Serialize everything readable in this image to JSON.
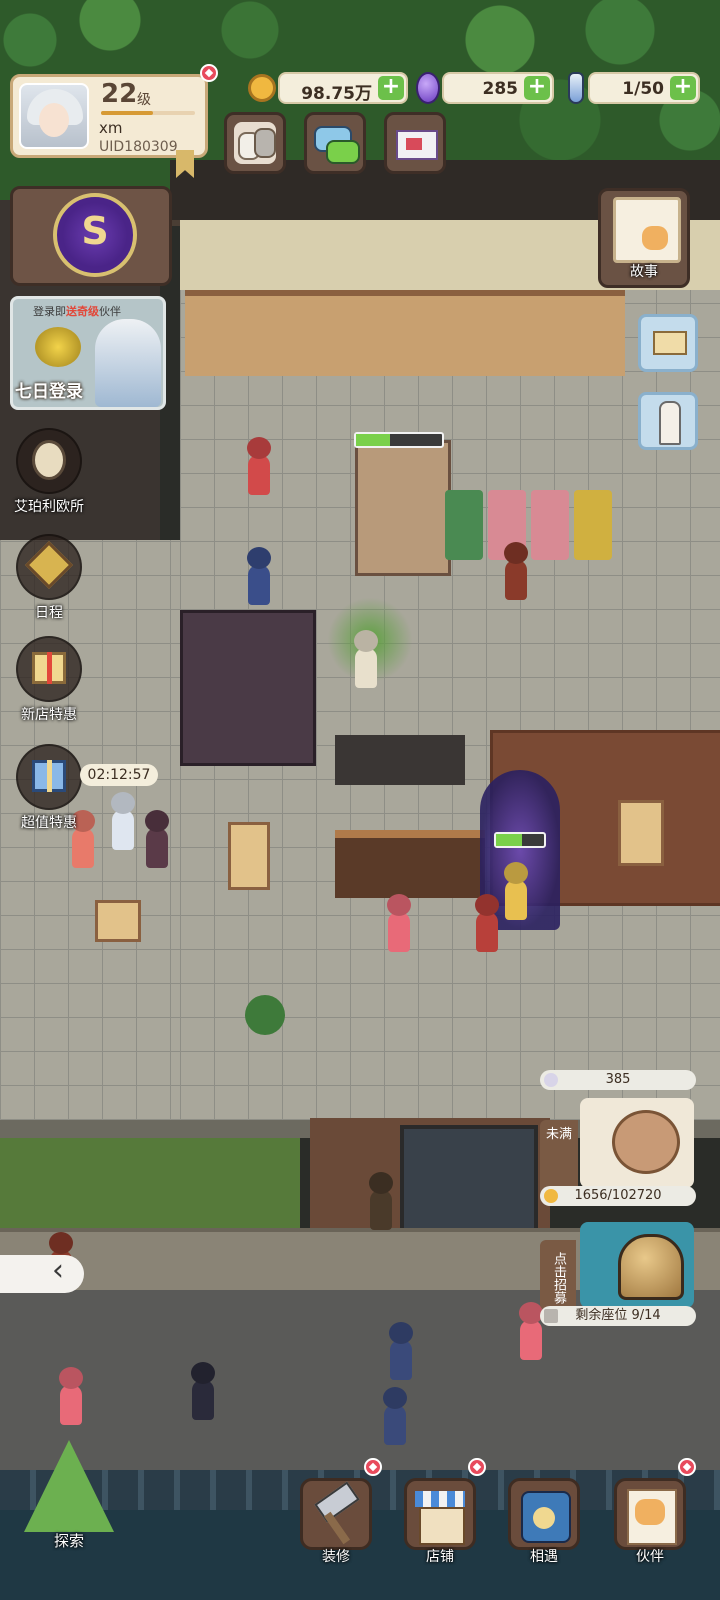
{
  "profile": {
    "level": "22",
    "level_unit": "级",
    "level_progress": 0.55,
    "username": "xm",
    "uid": "UID180309"
  },
  "resources": [
    {
      "icon": "gold-coin-icon",
      "value": "98.75万"
    },
    {
      "icon": "purple-gem-icon",
      "value": "285"
    },
    {
      "icon": "potion-bottle-icon",
      "value": "1/50"
    }
  ],
  "resource_plus": "+",
  "top_buttons": [
    "cat-friends-icon",
    "chat-bubble-icon",
    "mail-icon"
  ],
  "login_event": {
    "prefix": "登录即",
    "highlight": "送奇级",
    "suffix": "伙伴",
    "title": "七日登录"
  },
  "side_menu": [
    {
      "label": "艾珀利欧所",
      "icon": "owl-detective-icon"
    },
    {
      "label": "日程",
      "icon": "schedule-emblem-icon"
    },
    {
      "label": "新店特惠",
      "icon": "gift-box-icon"
    },
    {
      "label": "超值特惠",
      "icon": "blue-gift-box-icon"
    }
  ],
  "offer_timer": "02:12:57",
  "story": {
    "label": "故事"
  },
  "piggy_bank": {
    "top_value": "385",
    "status": "未满",
    "progress": "1656/102720"
  },
  "recruit": {
    "label": "点击招募",
    "seats": "剩余座位 9/14"
  },
  "bottom_nav": [
    {
      "label": "探索",
      "icon": "pinwheel-tree-icon"
    },
    {
      "label": "装修",
      "icon": "hammer-icon"
    },
    {
      "label": "店铺",
      "icon": "shop-front-icon"
    },
    {
      "label": "相遇",
      "icon": "telephone-icon"
    },
    {
      "label": "伙伴",
      "icon": "cat-card-icon"
    }
  ],
  "colors": {
    "plus_green": "#6cc04a",
    "notify_red": "#e84a5c",
    "panel_brown": "#6a5244",
    "cream": "#f4eedc"
  }
}
